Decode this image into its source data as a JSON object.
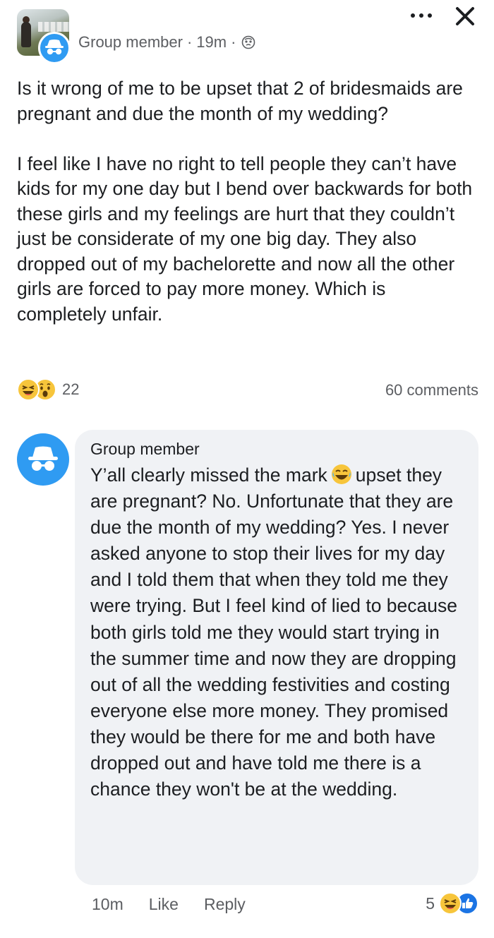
{
  "post": {
    "author": "Group member",
    "time": "19m",
    "separator": "·",
    "paragraphs": [
      "Is it wrong of me to be upset that 2 of bridesmaids are pregnant and due the month of my wedding?",
      "I feel like I have no right to tell people they can’t have kids for my one day but I bend over backwards for both these girls and my feelings are hurt that they couldn’t just be considerate of my one big day. They also dropped out of my bachelorette and now all the other girls are forced to pay more money. Which is completely unfair."
    ],
    "reaction_count": "22",
    "reaction_icons": [
      "haha-reaction-icon",
      "wow-reaction-icon"
    ],
    "comments_count": "60 comments"
  },
  "comment": {
    "author": "Group member",
    "text_before_emoji": "Y’all clearly missed the mark",
    "emoji": "laughing-tears-emoji",
    "text_after_emoji": "upset they are pregnant? No. Unfortunate that they are due the month of my wedding? Yes. I never asked anyone to stop their lives for my day and I told them that when they told me they were trying. But I feel kind of lied to because both girls told me they would start trying in the summer time and now they are dropping out of all the wedding festivities and costing everyone else more money. They promised they would be there for me and both have dropped out and have told me there is a chance they won't be at the wedding.",
    "time": "10m",
    "like_label": "Like",
    "reply_label": "Reply",
    "reaction_count": "5",
    "reaction_icons": [
      "haha-reaction-icon",
      "like-reaction-icon"
    ]
  },
  "colors": {
    "accent": "#2f9bf2",
    "like_blue": "#1b74e4",
    "secondary_text": "#5c5e62",
    "bubble": "#f0f2f5"
  }
}
